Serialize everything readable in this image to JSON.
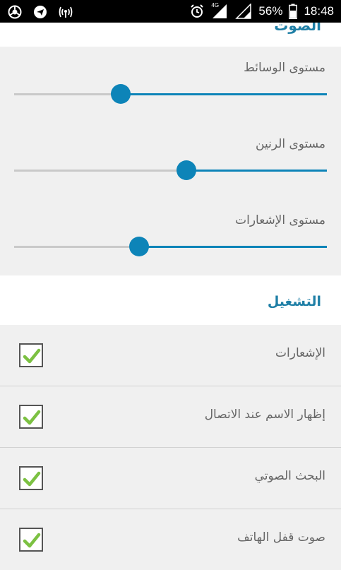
{
  "status_bar": {
    "battery": "56%",
    "time": "18:48",
    "network": "4G",
    "left_icons": [
      "chrome-icon",
      "telegram-icon",
      "hotspot-icon"
    ],
    "right_icons": [
      "alarm-icon",
      "signal-icon",
      "signal-icon-2",
      "battery-icon"
    ]
  },
  "sound_section": {
    "title": "الصوت",
    "sliders": [
      {
        "label": "مستوى الوسائط",
        "level": 0.66
      },
      {
        "label": "مستوى الرنين",
        "level": 0.45
      },
      {
        "label": "مستوى الإشعارات",
        "level": 0.6
      }
    ]
  },
  "playback_section": {
    "title": "التشغيل",
    "items": [
      {
        "label": "الإشعارات",
        "checked": true
      },
      {
        "label": "إظهار الاسم عند الاتصال",
        "checked": true
      },
      {
        "label": "البحث الصوتي",
        "checked": true
      },
      {
        "label": "صوت قفل الهاتف",
        "checked": true
      }
    ]
  },
  "colors": {
    "accent": "#0d84b8",
    "check": "#7cc142"
  }
}
